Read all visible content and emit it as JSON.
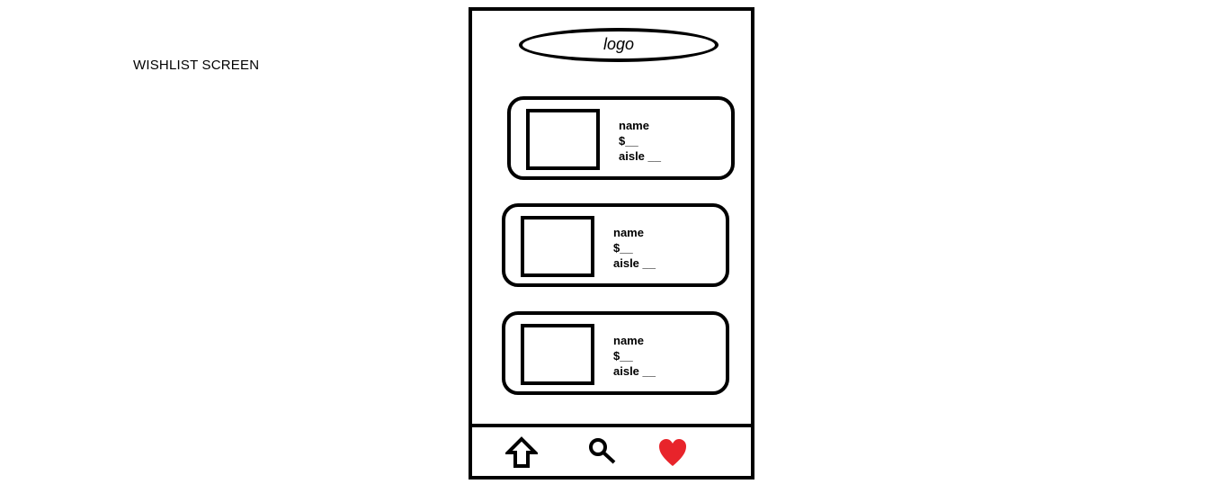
{
  "screen_label": "WISHLIST SCREEN",
  "header": {
    "logo_text": "logo"
  },
  "wishlist": {
    "items": [
      {
        "name": "name",
        "price": "$__",
        "aisle": "aisle __"
      },
      {
        "name": "name",
        "price": "$__",
        "aisle": "aisle __"
      },
      {
        "name": "name",
        "price": "$__",
        "aisle": "aisle __"
      }
    ]
  },
  "bottom_nav": {
    "items": [
      {
        "icon": "home-icon",
        "active": false
      },
      {
        "icon": "search-icon",
        "active": false
      },
      {
        "icon": "heart-icon",
        "active": true
      }
    ]
  },
  "colors": {
    "stroke": "#000000",
    "active_heart": "#e8242b"
  }
}
